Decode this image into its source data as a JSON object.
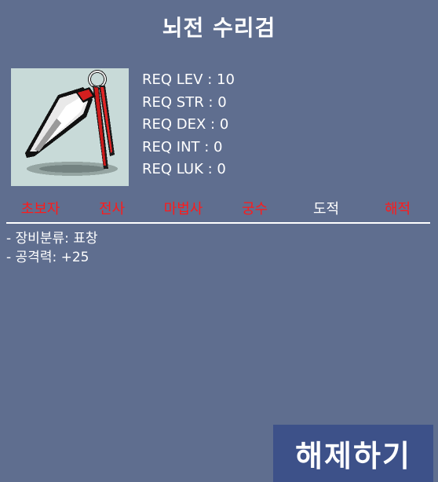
{
  "item": {
    "name": "뇌전 수리검",
    "icon": "throwing-star-icon"
  },
  "requirements": [
    {
      "label": "REQ LEV : 10"
    },
    {
      "label": "REQ STR : 0"
    },
    {
      "label": "REQ DEX : 0"
    },
    {
      "label": "REQ INT : 0"
    },
    {
      "label": "REQ LUK : 0"
    }
  ],
  "jobs": [
    {
      "name": "초보자",
      "available": false
    },
    {
      "name": "전사",
      "available": false
    },
    {
      "name": "마법사",
      "available": false
    },
    {
      "name": "궁수",
      "available": false
    },
    {
      "name": "도적",
      "available": true
    },
    {
      "name": "해적",
      "available": false
    }
  ],
  "stats": [
    {
      "text": "- 장비분류: 표창"
    },
    {
      "text": "- 공격력: +25"
    }
  ],
  "action": {
    "release_label": "해제하기"
  },
  "colors": {
    "background": "#5f6e8f",
    "unavailable_job": "#ff1a1a",
    "available_job": "#ffffff",
    "button": "#3d5189"
  }
}
